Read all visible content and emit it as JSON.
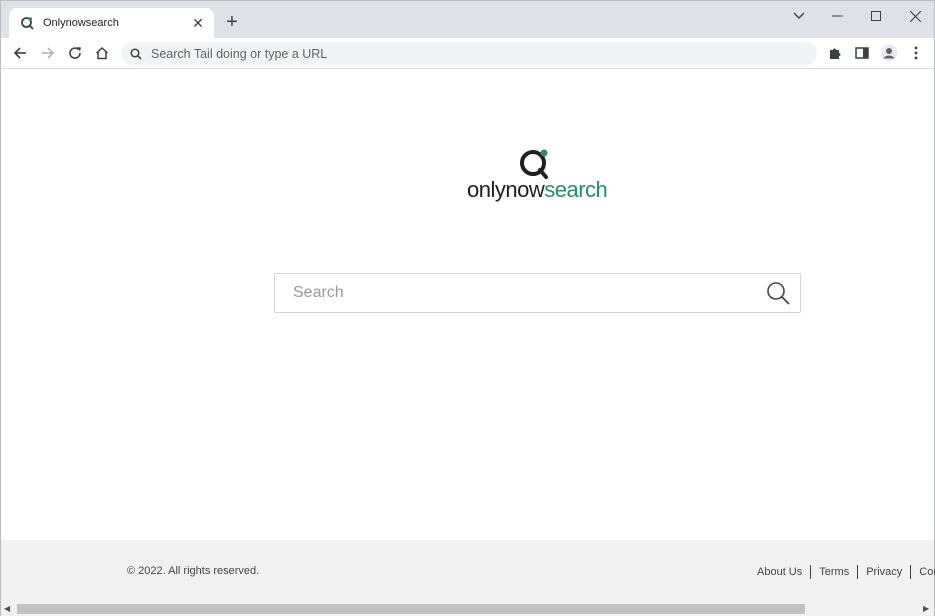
{
  "browser": {
    "tab": {
      "title": "Onlynowsearch",
      "close_glyph": "✕"
    },
    "new_tab_glyph": "+",
    "window_controls": {
      "dropdown": "⌄",
      "minimize": "—",
      "maximize": "☐",
      "close": "✕"
    },
    "omnibox": {
      "placeholder": "Search Tail doing or type a URL"
    }
  },
  "page": {
    "logo": {
      "text_part1": "onlynow",
      "text_part2": "search"
    },
    "search": {
      "placeholder": "Search"
    }
  },
  "footer": {
    "copyright": "© 2022. All rights reserved.",
    "links": [
      "About Us",
      "Terms",
      "Privacy",
      "Conta"
    ]
  },
  "colors": {
    "brand_green": "#2a8a6a",
    "logo_dark": "#1f1f1f"
  }
}
